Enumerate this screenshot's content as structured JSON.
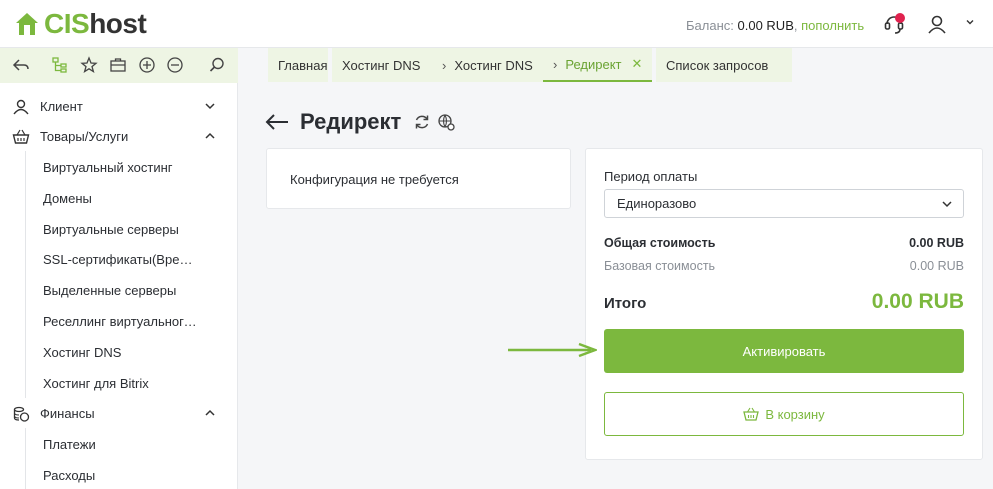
{
  "brand": {
    "logo_prefix": "CIS",
    "logo_suffix": "host",
    "accent": "#7cb83e",
    "notif_color": "#e0224e"
  },
  "header": {
    "balance_label": "Баланс:",
    "balance_value": "0.00 RUB",
    "topup_link": "пополнить"
  },
  "toolbar": {
    "icons": [
      "back-icon",
      "tree-icon",
      "star-icon",
      "briefcase-icon",
      "add-icon",
      "remove-icon",
      "search-icon"
    ]
  },
  "tabs": [
    {
      "label": "Главная"
    },
    {
      "label": "Хостинг DNS"
    },
    {
      "label": "Хостинг DNS"
    },
    {
      "label": "Редирект",
      "active": true
    },
    {
      "label": "Список запросов"
    }
  ],
  "sidebar": {
    "groups": [
      {
        "label": "Клиент",
        "expanded": false,
        "icon": "user-icon"
      },
      {
        "label": "Товары/Услуги",
        "expanded": true,
        "icon": "basket-icon",
        "items": [
          "Виртуальный хостинг",
          "Домены",
          "Виртуальные серверы",
          "SSL-сертификаты(Временно не доступно)",
          "Выделенные серверы",
          "Реселлинг виртуального хостинга",
          "Хостинг DNS",
          "Хостинг для Bitrix"
        ]
      },
      {
        "label": "Финансы",
        "expanded": true,
        "icon": "coins-icon",
        "items": [
          "Платежи",
          "Расходы"
        ]
      }
    ]
  },
  "page": {
    "title": "Редирект"
  },
  "config_card": {
    "text": "Конфигурация не требуется"
  },
  "order": {
    "period_label": "Период оплаты",
    "period_value": "Единоразово",
    "total_label": "Общая стоимость",
    "total_value": "0.00 RUB",
    "base_label": "Базовая стоимость",
    "base_value": "0.00 RUB",
    "itogo_label": "Итого",
    "itogo_value": "0.00 RUB",
    "activate_label": "Активировать",
    "cart_label": "В корзину"
  }
}
